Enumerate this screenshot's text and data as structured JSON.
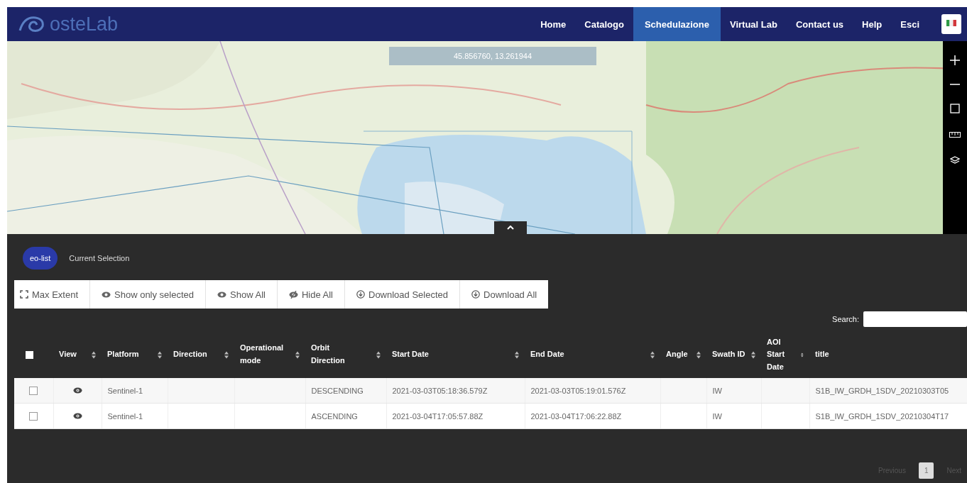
{
  "logo": {
    "text": "osteLab"
  },
  "nav": [
    {
      "label": "Home",
      "selected": false
    },
    {
      "label": "Catalogo",
      "selected": false
    },
    {
      "label": "Schedulazione",
      "selected": true
    },
    {
      "label": "Virtual Lab",
      "selected": false
    },
    {
      "label": "Contact us",
      "selected": false
    },
    {
      "label": "Help",
      "selected": false
    },
    {
      "label": "Esci",
      "selected": false
    }
  ],
  "map": {
    "kind": "picture",
    "coordinates": "45.856760, 13.261944"
  },
  "tabs": [
    {
      "label": "eo-list",
      "selected": true
    },
    {
      "label": "Current Selection",
      "selected": false
    }
  ],
  "toolbar": [
    {
      "kind": "extent",
      "label": "Max Extent"
    },
    {
      "kind": "eye",
      "label": "Show only selected"
    },
    {
      "kind": "eye",
      "label": "Show All"
    },
    {
      "kind": "eye-off",
      "label": "Hide All"
    },
    {
      "kind": "download",
      "label": "Download Selected"
    },
    {
      "kind": "download",
      "label": "Download All"
    }
  ],
  "search": {
    "label": "Search:"
  },
  "table": {
    "columns": [
      {
        "kind": "checkbox",
        "checked": false
      },
      {
        "kind": "icon",
        "label": "View",
        "sortable": true
      },
      {
        "kind": "text",
        "label": "Platform",
        "sortable": true
      },
      {
        "kind": "text",
        "label": "Direction",
        "sortable": true
      },
      {
        "kind": "text",
        "label": "Operational mode",
        "sortable": true
      },
      {
        "kind": "text",
        "label": "Orbit Direction",
        "sortable": true
      },
      {
        "kind": "text",
        "label": "Start Date",
        "sortable": true
      },
      {
        "kind": "text",
        "label": "End Date",
        "sortable": true
      },
      {
        "kind": "text",
        "label": "Angle",
        "sortable": true
      },
      {
        "kind": "text",
        "label": "Swath ID",
        "sortable": true
      },
      {
        "kind": "text",
        "label": "AOI Start Date",
        "sortable": true
      },
      {
        "kind": "text",
        "label": "title",
        "sortable": false
      }
    ],
    "rows": [
      {
        "checked": false,
        "cells": [
          "",
          "",
          "Sentinel-1",
          "",
          "",
          "DESCENDING",
          "2021-03-03T05:18:36.579Z",
          "2021-03-03T05:19:01.576Z",
          "",
          "IW",
          "",
          "S1B_IW_GRDH_1SDV_20210303T05"
        ]
      },
      {
        "checked": false,
        "cells": [
          "",
          "",
          "Sentinel-1",
          "",
          "",
          "ASCENDING",
          "2021-03-04T17:05:57.88Z",
          "2021-03-04T17:06:22.88Z",
          "",
          "IW",
          "",
          "S1B_IW_GRDH_1SDV_20210304T17"
        ]
      }
    ]
  },
  "pagination": [
    {
      "label": "Previous",
      "selected": false
    },
    {
      "label": "1",
      "selected": true
    },
    {
      "label": "Next",
      "selected": false
    }
  ]
}
